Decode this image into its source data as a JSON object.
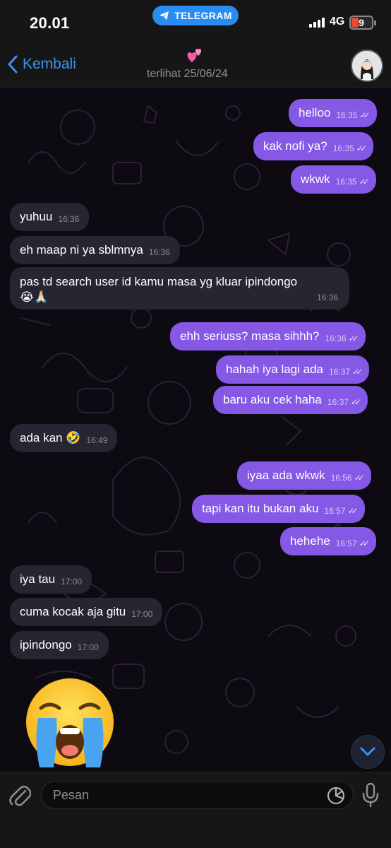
{
  "status_bar": {
    "time": "20.01",
    "app_pill": "TELEGRAM",
    "network": "4G",
    "battery": "9",
    "battery_color": "#e74a3b"
  },
  "header": {
    "back_label": "Kembali",
    "last_seen": "terlihat 25/06/24",
    "title_emoji": "💕"
  },
  "colors": {
    "outgoing_bubble": "#8658e6",
    "incoming_bubble": "#272531",
    "accent": "#3a93f4"
  },
  "messages": [
    {
      "dir": "out",
      "text": "helloo",
      "time": "16:35"
    },
    {
      "dir": "out",
      "text": "kak nofi ya?",
      "time": "16:35"
    },
    {
      "dir": "out",
      "text": "wkwk",
      "time": "16:35"
    },
    {
      "dir": "in",
      "text": "yuhuu",
      "time": "16:36"
    },
    {
      "dir": "in",
      "text": "eh maap ni ya sblmnya",
      "time": "16:36"
    },
    {
      "dir": "in",
      "text": "pas td search user id kamu masa yg kluar ipindongo",
      "text2": "😭🙏🏻",
      "time": "16:36"
    },
    {
      "dir": "out",
      "text": "ehh seriuss? masa sihhh?",
      "time": "16:36"
    },
    {
      "dir": "out",
      "text": "hahah iya lagi ada",
      "time": "16:37"
    },
    {
      "dir": "out",
      "text": "baru aku cek haha",
      "time": "16:37"
    },
    {
      "dir": "in",
      "text": "ada kan 🤣",
      "time": "16:49"
    },
    {
      "dir": "out",
      "text": "iyaa ada wkwk",
      "time": "16:56"
    },
    {
      "dir": "out",
      "text": "tapi kan itu bukan aku",
      "time": "16:57"
    },
    {
      "dir": "out",
      "text": "hehehe",
      "time": "16:57"
    },
    {
      "dir": "in",
      "text": "iya tau",
      "time": "17:00"
    },
    {
      "dir": "in",
      "text": "cuma kocak aja gitu",
      "time": "17:00"
    },
    {
      "dir": "in",
      "text": "ipindongo",
      "time": "17:00"
    }
  ],
  "big_emoji": "loudly-crying-face",
  "input": {
    "placeholder": "Pesan"
  },
  "icons": {
    "telegram": "telegram-icon",
    "back": "chevron-left-icon",
    "attach": "paperclip-icon",
    "sticker": "sticker-icon",
    "mic": "microphone-icon",
    "scroll": "chevron-down-icon",
    "read": "double-check-icon"
  }
}
